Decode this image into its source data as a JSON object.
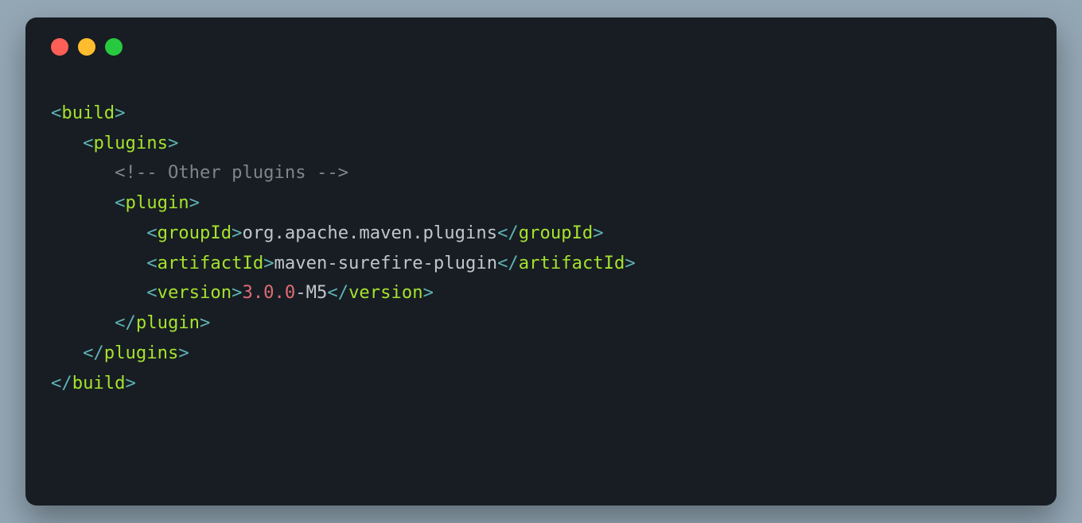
{
  "code": {
    "tags": {
      "build": "build",
      "plugins": "plugins",
      "plugin": "plugin",
      "groupId": "groupId",
      "artifactId": "artifactId",
      "version": "version"
    },
    "comment": "<!-- Other plugins -->",
    "groupId": "org.apache.maven.plugins",
    "artifactId": "maven-surefire-plugin",
    "versionNum": "3.0.0",
    "versionSuffix": "-M5",
    "indent1": "   ",
    "indent2": "      ",
    "indent3": "         "
  },
  "punct": {
    "lt": "<",
    "ltSlash": "</",
    "gt": ">"
  }
}
